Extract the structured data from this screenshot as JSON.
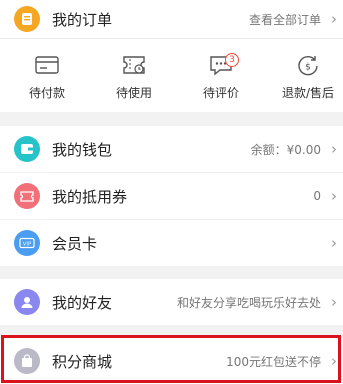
{
  "my_orders": {
    "title": "我的订单",
    "view_all": "查看全部订单"
  },
  "order_status": [
    {
      "label": "待付款",
      "icon": "wallet-card-icon"
    },
    {
      "label": "待使用",
      "icon": "ticket-clock-icon"
    },
    {
      "label": "待评价",
      "icon": "comment-icon",
      "badge": "3"
    },
    {
      "label": "退款/售后",
      "icon": "refund-icon"
    }
  ],
  "wallet": {
    "title": "我的钱包",
    "value": "余额：¥0.00"
  },
  "vouchers": {
    "title": "我的抵用券",
    "value": "0"
  },
  "member_card": {
    "title": "会员卡",
    "value": ""
  },
  "friends": {
    "title": "我的好友",
    "value": "和好友分享吃喝玩乐好去处"
  },
  "points_mall": {
    "title": "积分商城",
    "value": "100元红包送不停"
  },
  "colors": {
    "orders_icon": "#f5a623",
    "wallet_icon": "#26c4c9",
    "vouchers_icon": "#f2707a",
    "member_icon": "#4a9df0",
    "friends_icon": "#8a87ef",
    "points_icon": "#b9b9c8",
    "highlight": "#d9121b"
  }
}
